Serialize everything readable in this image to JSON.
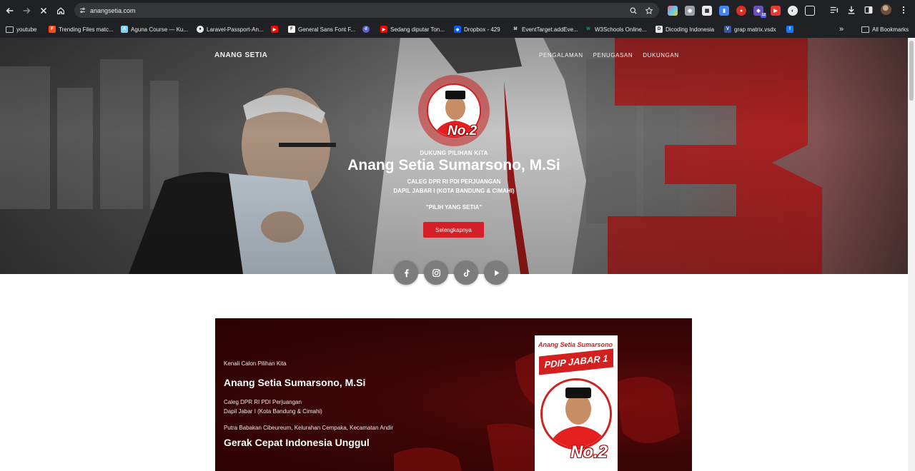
{
  "browser": {
    "url": "anangsetia.com",
    "bookmarks": [
      {
        "label": "youtube",
        "icon": "folder-icon"
      },
      {
        "label": "Trending Files matc...",
        "icon": "figma-icon"
      },
      {
        "label": "Aguna Course — Ku...",
        "icon": "aguna-icon"
      },
      {
        "label": "Laravel-Passport-An...",
        "icon": "github-icon"
      },
      {
        "label": "",
        "icon": "youtube-icon"
      },
      {
        "label": "General Sans Font F...",
        "icon": "font-f-icon"
      },
      {
        "label": "",
        "icon": "d-icon"
      },
      {
        "label": "Sedang diputar Ton...",
        "icon": "youtube-icon"
      },
      {
        "label": "Dropbox - 429",
        "icon": "dropbox-icon"
      },
      {
        "label": "EventTarget.addEve...",
        "icon": "mdn-icon"
      },
      {
        "label": "W3Schools Online...",
        "icon": "w3schools-icon"
      },
      {
        "label": "Dicoding Indonesia",
        "icon": "dicoding-icon"
      },
      {
        "label": "grap matrix.vsdx",
        "icon": "visio-icon"
      },
      {
        "label": "",
        "icon": "facebook-icon"
      }
    ],
    "all_bookmarks": "All Bookmarks",
    "more_bookmarks": "»",
    "extension_badge": "12"
  },
  "site": {
    "brand": "ANANG SETIA",
    "nav": [
      "PENGALAMAN",
      "PENUGASAN",
      "DUKUNGAN"
    ],
    "hero": {
      "number_badge": "No.2",
      "eyebrow": "DUKUNG PILIHAN KITA",
      "name": "Anang Setia Sumarsono, M.Si",
      "sub1": "CALEG DPR RI PDI PERJUANGAN",
      "sub2": "DAPIL JABAR I (KOTA BANDUNG & CIMAHI)",
      "tagline": "\"PILIH YANG SETIA\"",
      "cta": "Selengkapnya",
      "big_number": "3"
    },
    "socials": [
      "facebook-icon",
      "instagram-icon",
      "tiktok-icon",
      "youtube-play-icon"
    ],
    "intro": {
      "eyebrow": "Kenali Calon Pilihan Kita",
      "name": "Anang Setia Sumarsono, M.Si",
      "line1": "Caleg DPR RI PDI Perjuangan",
      "line2": "Dapil Jabar I (Kota Bandung & Cimahi)",
      "origin": "Putra Babakan Cibeureum, Kelurahan Cempaka, Kecamatan Andir",
      "slogan": "Gerak Cepat Indonesia Unggul",
      "poster_top": "Anang Setia Sumarsono",
      "poster_band": "PDIP JABAR 1",
      "poster_number": "No.2"
    }
  },
  "colors": {
    "accent_red": "#d41f26",
    "card_dark": "#3c0505",
    "chrome_bg": "#202124"
  }
}
